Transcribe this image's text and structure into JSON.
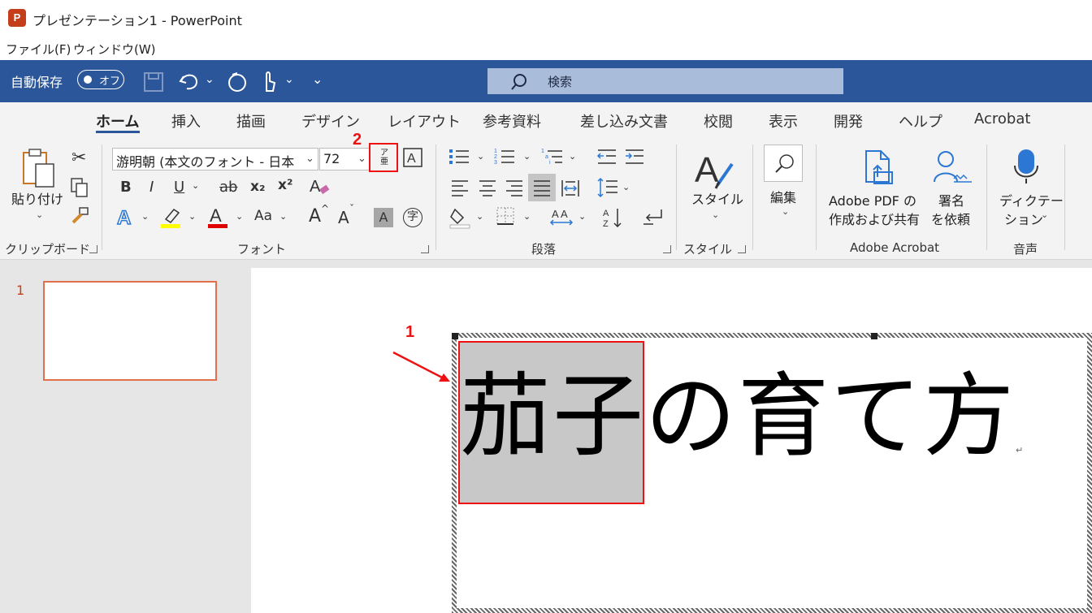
{
  "window": {
    "title": "プレゼンテーション1 - PowerPoint",
    "app_icon_letter": "P"
  },
  "menubar": {
    "items": [
      "ファイル(F)",
      "ウィンドウ(W)"
    ]
  },
  "qat": {
    "autosave_label": "自動保存",
    "autosave_state": "オフ",
    "search_placeholder": "検索"
  },
  "ribbon_tabs": [
    "ホーム",
    "挿入",
    "描画",
    "デザイン",
    "レイアウト",
    "参考資料",
    "差し込み文書",
    "校閲",
    "表示",
    "開発",
    "ヘルプ",
    "Acrobat"
  ],
  "active_tab": "ホーム",
  "clipboard": {
    "paste_label": "貼り付け",
    "group_label": "クリップボード"
  },
  "font": {
    "font_name": "游明朝 (本文のフォント - 日本",
    "font_size": "72",
    "phonetic_top": "ア",
    "phonetic_bottom": "亜",
    "group_label": "フォント",
    "bold": "B",
    "italic": "I",
    "underline": "U",
    "strike": "ab",
    "subscript": "x₂",
    "superscript": "x²",
    "font_color_sample": "A",
    "case_label": "Aa",
    "grow": "A",
    "shrink": "A",
    "char_shade": "A",
    "enclose": "字"
  },
  "paragraph": {
    "group_label": "段落"
  },
  "styles": {
    "button_label": "スタイル",
    "group_label": "スタイル"
  },
  "editing": {
    "button_label": "編集"
  },
  "acrobat": {
    "pdf_line1": "Adobe PDF の",
    "pdf_line2": "作成および共有",
    "sign_line1": "署名",
    "sign_line2": "を依頼",
    "group_label": "Adobe Acrobat"
  },
  "voice": {
    "dictate_line1": "ディクテー",
    "dictate_line2": "ション",
    "group_label": "音声"
  },
  "slides_pane": {
    "slide_number": "1"
  },
  "slide": {
    "title_text": "茄子の育て方",
    "paragraph_mark": "↵"
  },
  "annotations": {
    "callout1": "1",
    "callout2": "2"
  },
  "colors": {
    "ribbon_blue": "#2b579a",
    "callout_red": "#ee1111",
    "highlight_yellow": "#ffff00",
    "font_red": "#e00000"
  }
}
